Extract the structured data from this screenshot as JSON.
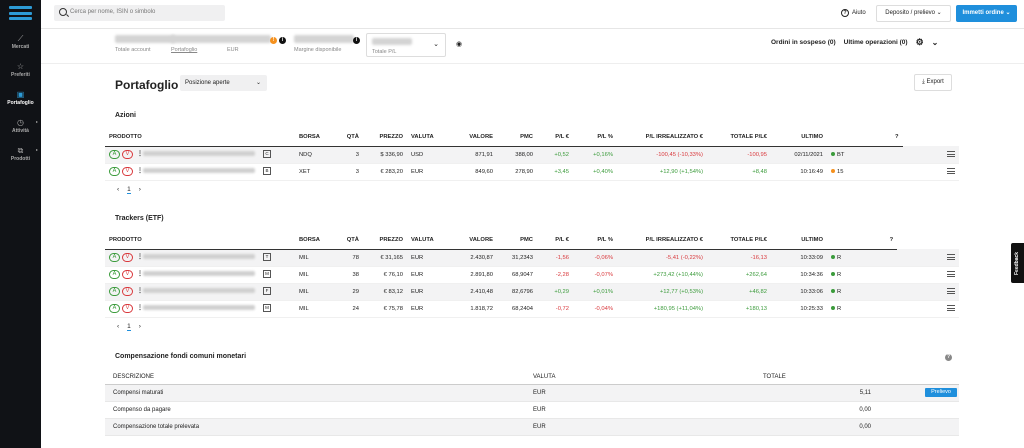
{
  "sidebar": {
    "items": [
      {
        "label": "Mercati",
        "icon": "chart-line-icon"
      },
      {
        "label": "Preferiti",
        "icon": "star-icon"
      },
      {
        "label": "Portafoglio",
        "icon": "portfolio-icon"
      },
      {
        "label": "Attività",
        "icon": "clock-icon"
      },
      {
        "label": "Prodotti",
        "icon": "products-icon"
      }
    ]
  },
  "topbar": {
    "search_placeholder": "Cerca per nome, ISIN o simbolo",
    "help": "Aiuto",
    "deposit_button": "Deposito / prelievo",
    "order_button": "Immetti ordine"
  },
  "account": {
    "labels": {
      "total": "Totale account",
      "portfolio": "Portafoglio",
      "currency": "EUR",
      "margin": "Margine disponibile",
      "pl": "Totale P/L"
    },
    "pending_orders": "Ordini in sospeso (0)",
    "last_ops": "Ultime operazioni (0)"
  },
  "main": {
    "title": "Portafoglio",
    "position_select": "Posizione aperte",
    "export": "Export"
  },
  "azioni": {
    "title": "Azioni",
    "headers": [
      "PRODOTTO",
      "BORSA",
      "QTÀ",
      "PREZZO",
      "VALUTA",
      "VALORE",
      "PMC",
      "P/L €",
      "P/L %",
      "P/L IRREALIZZATO €",
      "TOTALE P/L€",
      "ULTIMO"
    ],
    "rows": [
      {
        "ex": "C",
        "borsa": "NDQ",
        "qty": "3",
        "prezzo": "$ 336,90",
        "valuta": "USD",
        "valore": "871,91",
        "pmc": "388,00",
        "pl": "+0,52",
        "plp": "+0,16%",
        "plirr": "-100,45 (-10,33%)",
        "tot": "-100,95",
        "ultimo": "02/11/2021",
        "st": "BT"
      },
      {
        "ex": "B",
        "borsa": "XET",
        "qty": "3",
        "prezzo": "€ 283,20",
        "valuta": "EUR",
        "valore": "849,60",
        "pmc": "278,90",
        "pl": "+3,45",
        "plp": "+0,40%",
        "plirr": "+12,90 (+1,54%)",
        "tot": "+8,48",
        "ultimo": "10:16:49",
        "st": "15"
      }
    ]
  },
  "etf": {
    "title": "Trackers (ETF)",
    "rows": [
      {
        "ex": "T",
        "borsa": "MIL",
        "qty": "78",
        "prezzo": "€ 31,165",
        "valuta": "EUR",
        "valore": "2.430,87",
        "pmc": "31,2343",
        "pl": "-1,56",
        "plp": "-0,06%",
        "plirr": "-5,41 (-0,22%)",
        "tot": "-16,13",
        "ultimo": "10:33:09",
        "st": "R"
      },
      {
        "ex": "M",
        "borsa": "MIL",
        "qty": "38",
        "prezzo": "€ 76,10",
        "valuta": "EUR",
        "valore": "2.891,80",
        "pmc": "68,9047",
        "pl": "-2,28",
        "plp": "-0,07%",
        "plirr": "+273,42 (+10,44%)",
        "tot": "+262,64",
        "ultimo": "10:34:36",
        "st": "R"
      },
      {
        "ex": "F",
        "borsa": "MIL",
        "qty": "29",
        "prezzo": "€ 83,12",
        "valuta": "EUR",
        "valore": "2.410,48",
        "pmc": "82,6796",
        "pl": "+0,29",
        "plp": "+0,01%",
        "plirr": "+12,77 (+0,53%)",
        "tot": "+46,82",
        "ultimo": "10:33:06",
        "st": "R"
      },
      {
        "ex": "M",
        "borsa": "MIL",
        "qty": "24",
        "prezzo": "€ 75,78",
        "valuta": "EUR",
        "valore": "1.818,72",
        "pmc": "68,2404",
        "pl": "-0,72",
        "plp": "-0,04%",
        "plirr": "+180,95 (+11,04%)",
        "tot": "+180,13",
        "ultimo": "10:25:33",
        "st": "R"
      }
    ]
  },
  "pager": {
    "prev": "‹",
    "page": "1",
    "next": "›"
  },
  "comp": {
    "title": "Compensazione fondi comuni monetari",
    "headers": [
      "DESCRIZIONE",
      "VALUTA",
      "TOTALE"
    ],
    "rows": [
      {
        "d": "Compensi maturati",
        "v": "EUR",
        "t": "5,11"
      },
      {
        "d": "Compenso da pagare",
        "v": "EUR",
        "t": "0,00"
      },
      {
        "d": "Compensazione totale prelevata",
        "v": "EUR",
        "t": "0,00"
      }
    ],
    "prelievo": "Prelievo"
  },
  "feedback": "Feedback"
}
